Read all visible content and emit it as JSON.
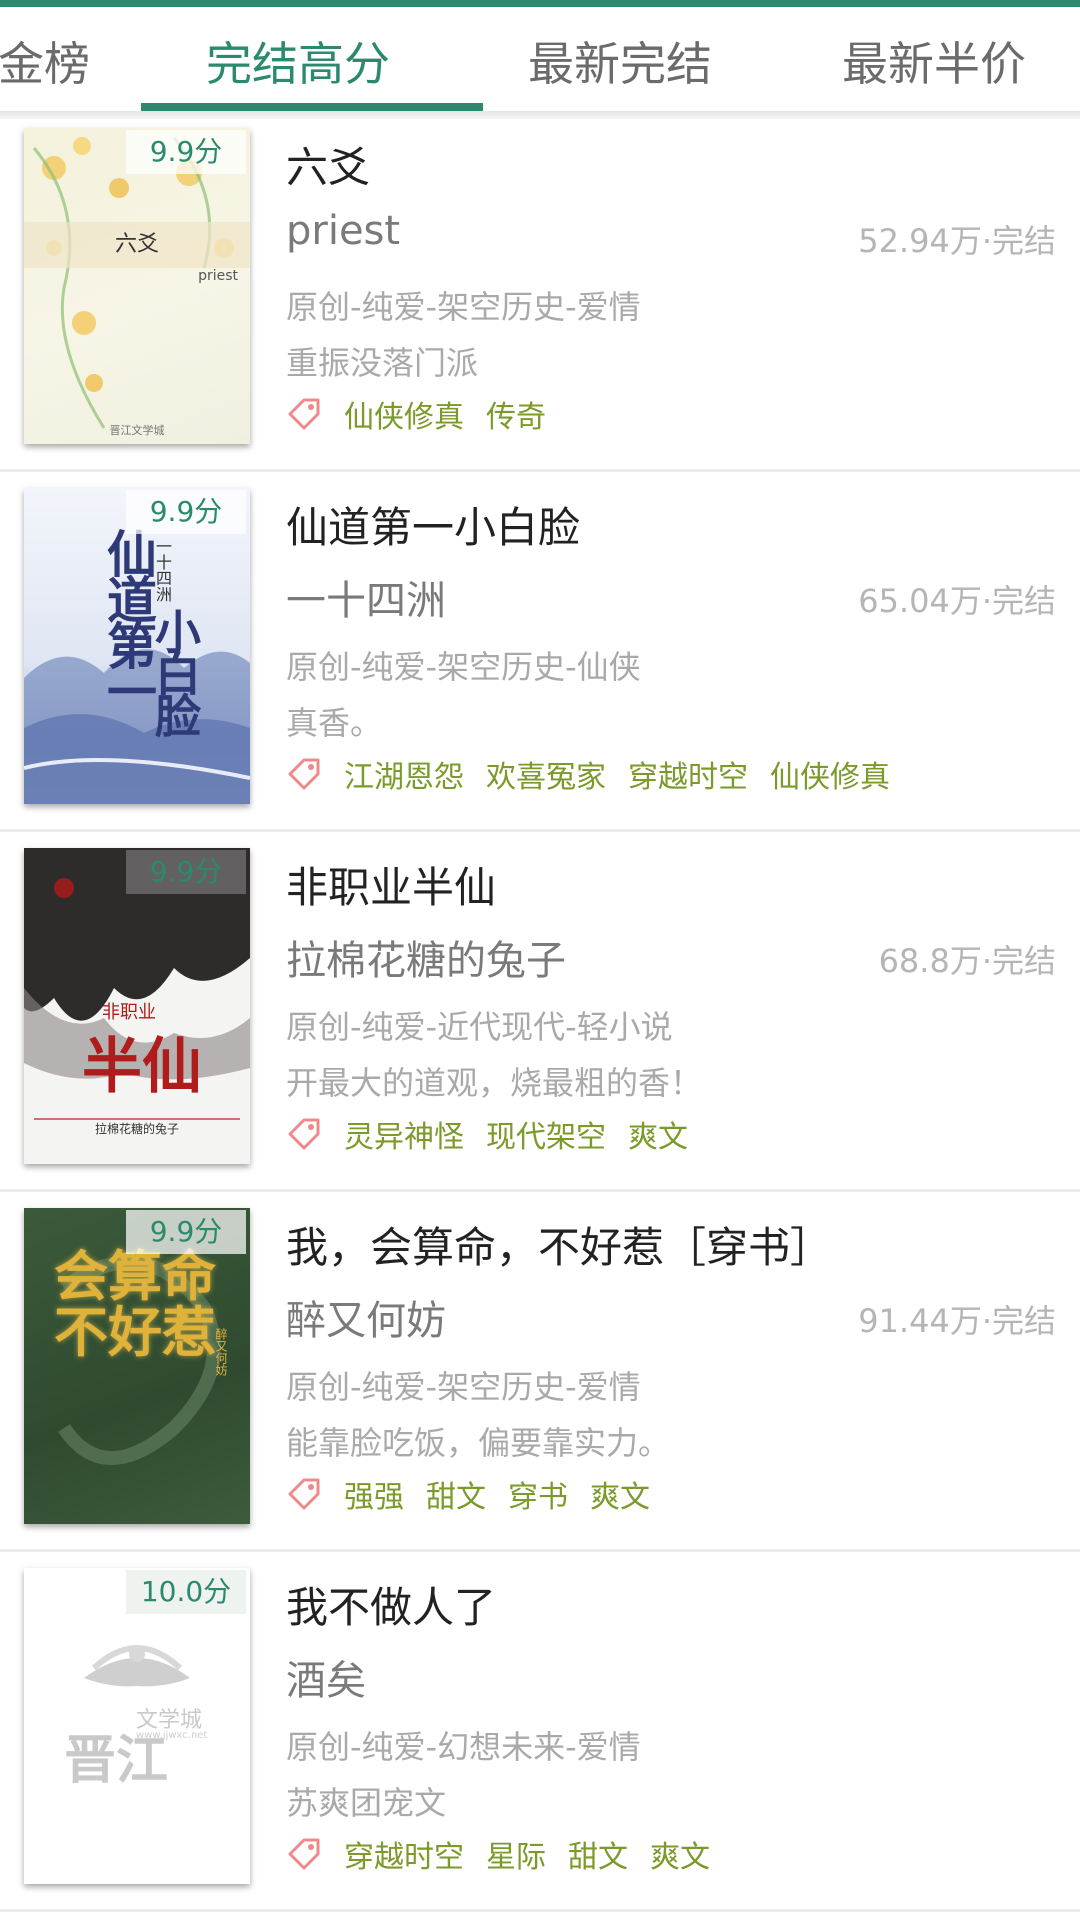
{
  "tabs": [
    {
      "label": "金榜",
      "active": false
    },
    {
      "label": "完结高分",
      "active": true
    },
    {
      "label": "最新完结",
      "active": false
    },
    {
      "label": "最新半价",
      "active": false
    }
  ],
  "books": [
    {
      "score": "9.9分",
      "title": "六爻",
      "author": "priest",
      "meta": "52.94万·完结",
      "genre": "原创-纯爱-架空历史-爱情",
      "intro": "重振没落门派",
      "tags": [
        "仙侠修真",
        "传奇"
      ],
      "cover": {
        "title": "六爻",
        "author": "priest",
        "publisher": "晋江文学城"
      }
    },
    {
      "score": "9.9分",
      "title": "仙道第一小白脸",
      "author": "一十四洲",
      "meta": "65.04万·完结",
      "genre": "原创-纯爱-架空历史-仙侠",
      "intro": "真香。",
      "tags": [
        "江湖恩怨",
        "欢喜冤家",
        "穿越时空",
        "仙侠修真"
      ],
      "cover": {
        "title_a": "仙道第一",
        "title_b": "小白脸",
        "author": "一十四洲"
      }
    },
    {
      "score": "9.9分",
      "title": "非职业半仙",
      "author": "拉棉花糖的兔子",
      "meta": "68.8万·完结",
      "genre": "原创-纯爱-近代现代-轻小说",
      "intro": "开最大的道观，烧最粗的香！",
      "tags": [
        "灵异神怪",
        "现代架空",
        "爽文"
      ],
      "cover": {
        "title_a": "非职业",
        "title_b": "半仙",
        "author": "拉棉花糖的兔子"
      }
    },
    {
      "score": "9.9分",
      "title": "我，会算命，不好惹［穿书］",
      "author": "醉又何妨",
      "meta": "91.44万·完结",
      "genre": "原创-纯爱-架空历史-爱情",
      "intro": "能靠脸吃饭，偏要靠实力。",
      "tags": [
        "强强",
        "甜文",
        "穿书",
        "爽文"
      ],
      "cover": {
        "title": "会算命不好惹",
        "author": "醉又何妨"
      }
    },
    {
      "score": "10.0分",
      "title": "我不做人了",
      "author": "酒矣",
      "meta": "",
      "genre": "原创-纯爱-幻想未来-爱情",
      "intro": "苏爽团宠文",
      "tags": [
        "穿越时空",
        "星际",
        "甜文",
        "爽文"
      ],
      "cover": {
        "logo": "晋江",
        "logo_sub": "文学城",
        "url": "www.jjwxc.net"
      }
    }
  ],
  "colors": {
    "accent": "#2b8a6e",
    "tag": "#7b9a2a",
    "tag_icon": "#f08a8a"
  }
}
